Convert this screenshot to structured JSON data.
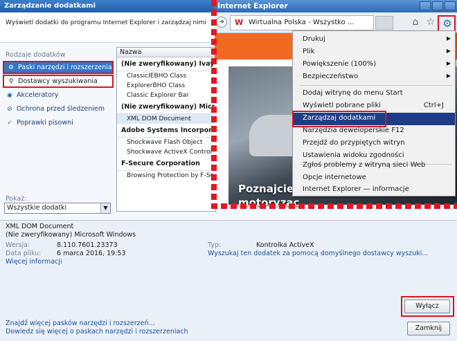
{
  "dialog": {
    "title": "Zarządzanie dodatkami",
    "description": "Wyświetl dodatki do programu Internet Explorer i zarządzaj nimi",
    "types_label": "Rodzaje dodatków",
    "types": [
      {
        "label": "Paski narzędzi i rozszerzenia",
        "icon": "gear-icon"
      },
      {
        "label": "Dostawcy wyszukiwania",
        "icon": "search-icon"
      },
      {
        "label": "Akceleratory",
        "icon": "accelerator-icon"
      },
      {
        "label": "Ochrona przed śledzeniem",
        "icon": "block-icon"
      },
      {
        "label": "Poprawki pisowni",
        "icon": "spellcheck-icon"
      }
    ],
    "show_label": "Pokaż:",
    "show_value": "Wszystkie dodatki",
    "list_header": "Nazwa",
    "groups": [
      {
        "name": "(Nie zweryfikowany) Ivaylo",
        "items": [
          "ClassicIEBHO Class",
          "ExplorerBHO Class",
          "Classic Explorer Bar"
        ]
      },
      {
        "name": "(Nie zweryfikowany) Microso",
        "items": [
          "XML DOM Document"
        ]
      },
      {
        "name": "Adobe Systems Incorporate",
        "items": [
          "Shockwave Flash Object",
          "Shockwave ActiveX Control"
        ]
      },
      {
        "name": "F-Secure Corporation",
        "items": [
          "Browsing Protection by F-Secu..."
        ]
      }
    ],
    "details": {
      "name": "XML DOM Document",
      "publisher": "(Nie zweryfikowany) Microsoft Windows",
      "version_label": "Wersja:",
      "version": "8.110.7601.23373",
      "date_label": "Data pliku:",
      "date": "6 marca 2016, 19:53",
      "more_info": "Więcej informacji",
      "type_label": "Typ:",
      "type": "Kontrolka ActiveX",
      "search_text": "Wyszukaj ten dodatek za pomocą domyślnego dostawcy wyszuki..."
    },
    "disable_button": "Wyłącz",
    "close_button": "Zamknij",
    "link_find": "Znajdź więcej pasków narzędzi i rozszerzeń...",
    "link_learn": "Dowiedz się więcej o paskach narzędzi i rozszerzeniach"
  },
  "ie": {
    "title": "Internet Explorer",
    "tab_title": "Wirtualna Polska - Wszystko ...",
    "tab_logo": "W",
    "caption_line1": "Poznajcie",
    "caption_line2": "motoryzac"
  },
  "menu": {
    "items": [
      {
        "label": "Drukuj",
        "submenu": true
      },
      {
        "label": "Plik",
        "submenu": true
      },
      {
        "label": "Powiększenie (100%)",
        "submenu": true
      },
      {
        "label": "Bezpieczeństwo",
        "submenu": true
      },
      {
        "label": "Dodaj witrynę do menu Start"
      },
      {
        "label": "Wyświetl pobrane pliki",
        "shortcut": "Ctrl+J"
      },
      {
        "label": "Zarządzaj dodatkami"
      },
      {
        "label": "Narzędzia deweloperskie F12"
      },
      {
        "label": "Przejdź do przypiętych witryn"
      },
      {
        "label": "Ustawienia widoku zgodności"
      },
      {
        "label": "Zgłoś problemy z witryną sieci Web"
      },
      {
        "label": "Opcje internetowe"
      },
      {
        "label": "Internet Explorer — informacje"
      }
    ]
  },
  "colors": {
    "highlight": "#d9141c",
    "selection": "#3277c8",
    "menu_selection": "#1f3d86",
    "accent_orange": "#f26a21"
  }
}
